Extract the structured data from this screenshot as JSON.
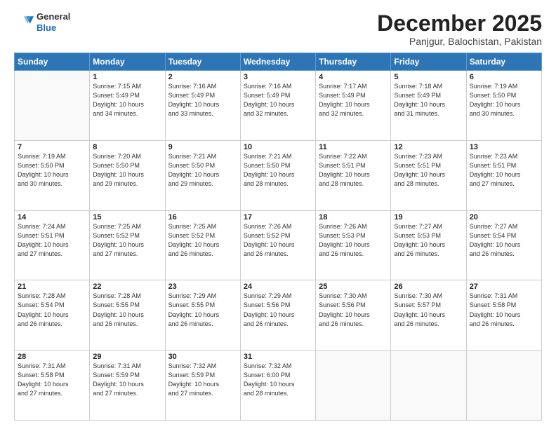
{
  "header": {
    "logo_general": "General",
    "logo_blue": "Blue",
    "month_title": "December 2025",
    "location": "Panjgur, Balochistan, Pakistan"
  },
  "weekdays": [
    "Sunday",
    "Monday",
    "Tuesday",
    "Wednesday",
    "Thursday",
    "Friday",
    "Saturday"
  ],
  "weeks": [
    [
      {
        "day": "",
        "info": ""
      },
      {
        "day": "1",
        "info": "Sunrise: 7:15 AM\nSunset: 5:49 PM\nDaylight: 10 hours\nand 34 minutes."
      },
      {
        "day": "2",
        "info": "Sunrise: 7:16 AM\nSunset: 5:49 PM\nDaylight: 10 hours\nand 33 minutes."
      },
      {
        "day": "3",
        "info": "Sunrise: 7:16 AM\nSunset: 5:49 PM\nDaylight: 10 hours\nand 32 minutes."
      },
      {
        "day": "4",
        "info": "Sunrise: 7:17 AM\nSunset: 5:49 PM\nDaylight: 10 hours\nand 32 minutes."
      },
      {
        "day": "5",
        "info": "Sunrise: 7:18 AM\nSunset: 5:49 PM\nDaylight: 10 hours\nand 31 minutes."
      },
      {
        "day": "6",
        "info": "Sunrise: 7:19 AM\nSunset: 5:50 PM\nDaylight: 10 hours\nand 30 minutes."
      }
    ],
    [
      {
        "day": "7",
        "info": "Sunrise: 7:19 AM\nSunset: 5:50 PM\nDaylight: 10 hours\nand 30 minutes."
      },
      {
        "day": "8",
        "info": "Sunrise: 7:20 AM\nSunset: 5:50 PM\nDaylight: 10 hours\nand 29 minutes."
      },
      {
        "day": "9",
        "info": "Sunrise: 7:21 AM\nSunset: 5:50 PM\nDaylight: 10 hours\nand 29 minutes."
      },
      {
        "day": "10",
        "info": "Sunrise: 7:21 AM\nSunset: 5:50 PM\nDaylight: 10 hours\nand 28 minutes."
      },
      {
        "day": "11",
        "info": "Sunrise: 7:22 AM\nSunset: 5:51 PM\nDaylight: 10 hours\nand 28 minutes."
      },
      {
        "day": "12",
        "info": "Sunrise: 7:23 AM\nSunset: 5:51 PM\nDaylight: 10 hours\nand 28 minutes."
      },
      {
        "day": "13",
        "info": "Sunrise: 7:23 AM\nSunset: 5:51 PM\nDaylight: 10 hours\nand 27 minutes."
      }
    ],
    [
      {
        "day": "14",
        "info": "Sunrise: 7:24 AM\nSunset: 5:51 PM\nDaylight: 10 hours\nand 27 minutes."
      },
      {
        "day": "15",
        "info": "Sunrise: 7:25 AM\nSunset: 5:52 PM\nDaylight: 10 hours\nand 27 minutes."
      },
      {
        "day": "16",
        "info": "Sunrise: 7:25 AM\nSunset: 5:52 PM\nDaylight: 10 hours\nand 26 minutes."
      },
      {
        "day": "17",
        "info": "Sunrise: 7:26 AM\nSunset: 5:52 PM\nDaylight: 10 hours\nand 26 minutes."
      },
      {
        "day": "18",
        "info": "Sunrise: 7:26 AM\nSunset: 5:53 PM\nDaylight: 10 hours\nand 26 minutes."
      },
      {
        "day": "19",
        "info": "Sunrise: 7:27 AM\nSunset: 5:53 PM\nDaylight: 10 hours\nand 26 minutes."
      },
      {
        "day": "20",
        "info": "Sunrise: 7:27 AM\nSunset: 5:54 PM\nDaylight: 10 hours\nand 26 minutes."
      }
    ],
    [
      {
        "day": "21",
        "info": "Sunrise: 7:28 AM\nSunset: 5:54 PM\nDaylight: 10 hours\nand 26 minutes."
      },
      {
        "day": "22",
        "info": "Sunrise: 7:28 AM\nSunset: 5:55 PM\nDaylight: 10 hours\nand 26 minutes."
      },
      {
        "day": "23",
        "info": "Sunrise: 7:29 AM\nSunset: 5:55 PM\nDaylight: 10 hours\nand 26 minutes."
      },
      {
        "day": "24",
        "info": "Sunrise: 7:29 AM\nSunset: 5:56 PM\nDaylight: 10 hours\nand 26 minutes."
      },
      {
        "day": "25",
        "info": "Sunrise: 7:30 AM\nSunset: 5:56 PM\nDaylight: 10 hours\nand 26 minutes."
      },
      {
        "day": "26",
        "info": "Sunrise: 7:30 AM\nSunset: 5:57 PM\nDaylight: 10 hours\nand 26 minutes."
      },
      {
        "day": "27",
        "info": "Sunrise: 7:31 AM\nSunset: 5:58 PM\nDaylight: 10 hours\nand 26 minutes."
      }
    ],
    [
      {
        "day": "28",
        "info": "Sunrise: 7:31 AM\nSunset: 5:58 PM\nDaylight: 10 hours\nand 27 minutes."
      },
      {
        "day": "29",
        "info": "Sunrise: 7:31 AM\nSunset: 5:59 PM\nDaylight: 10 hours\nand 27 minutes."
      },
      {
        "day": "30",
        "info": "Sunrise: 7:32 AM\nSunset: 5:59 PM\nDaylight: 10 hours\nand 27 minutes."
      },
      {
        "day": "31",
        "info": "Sunrise: 7:32 AM\nSunset: 6:00 PM\nDaylight: 10 hours\nand 28 minutes."
      },
      {
        "day": "",
        "info": ""
      },
      {
        "day": "",
        "info": ""
      },
      {
        "day": "",
        "info": ""
      }
    ]
  ]
}
